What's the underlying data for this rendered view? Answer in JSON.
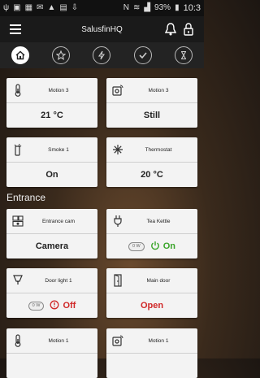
{
  "status_bar": {
    "battery": "93%",
    "time": "10:3"
  },
  "app": {
    "title": "SalusfinHQ"
  },
  "tabs": [
    {
      "name": "home",
      "active": true
    },
    {
      "name": "favorites",
      "active": false
    },
    {
      "name": "energy",
      "active": false
    },
    {
      "name": "check",
      "active": false
    },
    {
      "name": "timer",
      "active": false
    }
  ],
  "devices": {
    "motion3_temp": {
      "name": "Motion 3",
      "value": "21 °C",
      "icon": "thermometer-icon"
    },
    "motion3_state": {
      "name": "Motion 3",
      "value": "Still",
      "icon": "motion-sensor-icon"
    },
    "smoke1": {
      "name": "Smoke 1",
      "value": "On",
      "icon": "smoke-detector-icon"
    },
    "thermostat": {
      "name": "Thermostat",
      "value": "20 °C",
      "icon": "snowflake-icon"
    },
    "entrance_cam": {
      "name": "Entrance cam",
      "value": "Camera",
      "icon": "camera-icon"
    },
    "tea_kettle": {
      "name": "Tea Kettle",
      "power": "0 W",
      "value": "On",
      "icon": "plug-icon"
    },
    "door_light1": {
      "name": "Door light 1",
      "power": "0 W",
      "value": "Off",
      "icon": "bulb-icon"
    },
    "main_door": {
      "name": "Main door",
      "value": "Open",
      "icon": "door-icon"
    },
    "motion1_temp": {
      "name": "Motion 1",
      "icon": "thermometer-icon"
    },
    "motion1_state": {
      "name": "Motion 1",
      "icon": "motion-sensor-icon"
    }
  },
  "sections": {
    "entrance": "Entrance"
  },
  "colors": {
    "on": "#3aa52a",
    "off": "#d02828"
  }
}
